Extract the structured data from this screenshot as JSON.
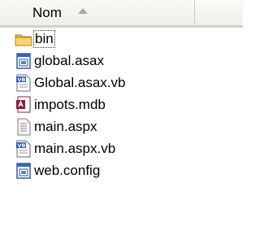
{
  "header": {
    "name_column": "Nom"
  },
  "files": [
    {
      "name": "bin",
      "icon": "folder-icon"
    },
    {
      "name": "global.asax",
      "icon": "asax-icon"
    },
    {
      "name": "Global.asax.vb",
      "icon": "vb-file-icon"
    },
    {
      "name": "impots.mdb",
      "icon": "access-db-icon"
    },
    {
      "name": "main.aspx",
      "icon": "aspx-icon"
    },
    {
      "name": "main.aspx.vb",
      "icon": "vb-file-icon"
    },
    {
      "name": "web.config",
      "icon": "config-icon"
    }
  ],
  "colors": {
    "folder": "#f2c44a",
    "header_bg": "#ecebe4"
  }
}
